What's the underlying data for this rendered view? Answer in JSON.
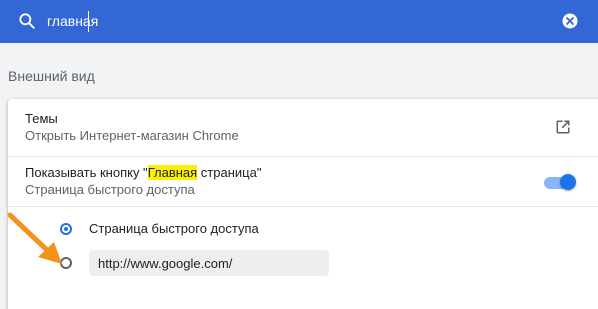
{
  "search": {
    "value": "главная",
    "icon": "search-icon",
    "clear_icon": "clear-icon"
  },
  "section": {
    "title": "Внешний вид"
  },
  "themes": {
    "label": "Темы",
    "sublabel": "Открыть Интернет-магазин Chrome",
    "icon": "external-link-icon"
  },
  "home_button": {
    "label_before": "Показывать кнопку \"",
    "label_highlight": "Главная",
    "label_after": " страница\"",
    "sublabel": "Страница быстрого доступа",
    "toggle_on": true
  },
  "home_options": {
    "selected": "new-tab-page",
    "options": [
      {
        "id": "new-tab-page",
        "label": "Страница быстрого доступа"
      }
    ],
    "custom_url_value": "http://www.google.com/"
  },
  "annotation": {
    "arrow_icon": "arrow-icon",
    "arrow_color": "#f5921e"
  },
  "colors": {
    "accent": "#1a73e8",
    "topbar": "#3367d6",
    "highlight": "#fcf000"
  }
}
